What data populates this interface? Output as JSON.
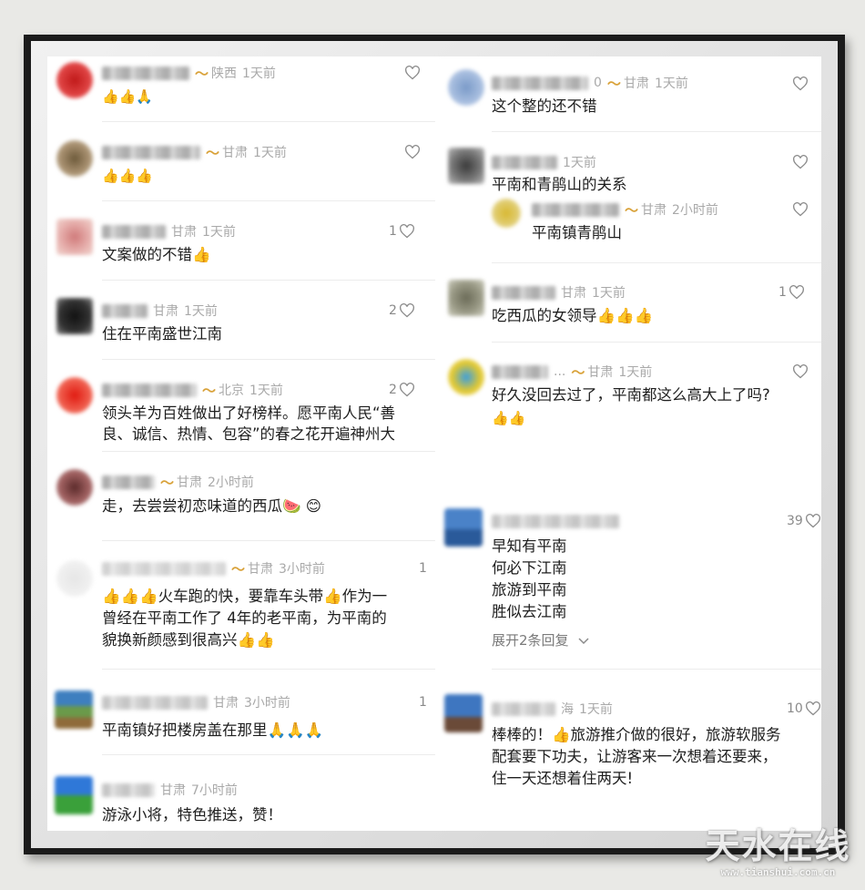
{
  "colors": {
    "badge": "#d9a23a",
    "meta_gray": "#a9a9a9",
    "text": "#1e1e1e",
    "frame": "#1b1b1b"
  },
  "icons": {
    "like": "heart-outline-icon",
    "expand": "chevron-down-icon",
    "badge": "vip-badge-icon"
  },
  "left_comments": [
    {
      "location": "陕西",
      "time": "1天前",
      "text": "👍👍🙏",
      "likes": ""
    },
    {
      "location": "甘肃",
      "time": "1天前",
      "text": "👍👍👍",
      "likes": ""
    },
    {
      "location": "甘肃",
      "time": "1天前",
      "text": "文案做的不错👍",
      "likes": "1"
    },
    {
      "location": "甘肃",
      "time": "1天前",
      "text": "住在平南盛世江南",
      "likes": "2"
    },
    {
      "location": "北京",
      "time": "1天前",
      "text_lines": [
        "领头羊为百姓做出了好榜样。愿平南人民“善",
        "良、诚信、热情、包容”的春之花开遍神州大"
      ],
      "likes": "2"
    },
    {
      "location": "甘肃",
      "time": "2小时前",
      "text": "走，去尝尝初恋味道的西瓜🍉 😊",
      "likes": ""
    },
    {
      "location": "甘肃",
      "time": "3小时前",
      "text_lines": [
        "👍👍👍火车跑的快，要靠车头带👍作为一",
        "曾经在平南工作了 4年的老平南，为平南的",
        "貌换新颜感到很高兴👍👍"
      ],
      "likes": "1"
    },
    {
      "location": "甘肃",
      "time": "3小时前",
      "text": "平南镇好把楼房盖在那里🙏🙏🙏",
      "likes": "1"
    },
    {
      "location": "甘肃",
      "time": "7小时前",
      "text": "游泳小将，特色推送，赞！",
      "likes": ""
    }
  ],
  "right_comments": [
    {
      "name_tail": "0",
      "location": "甘肃",
      "time": "1天前",
      "text": "这个整的还不错",
      "likes": ""
    },
    {
      "location": "",
      "time": "1天前",
      "text": "平南和青鹃山的关系",
      "likes": ""
    },
    {
      "location": "甘肃",
      "time": "2小时前",
      "text": "平南镇青鹃山",
      "likes": ""
    },
    {
      "location": "甘肃",
      "time": "1天前",
      "text": "吃西瓜的女领导👍👍👍",
      "likes": "1"
    },
    {
      "name_tail": "...",
      "location": "甘肃",
      "time": "1天前",
      "text_lines": [
        "好久没回去过了，平南都这么高大上了吗?",
        "👍👍"
      ],
      "likes": ""
    },
    {
      "location": "",
      "time": "",
      "text_lines": [
        "早知有平南",
        "何必下江南",
        "旅游到平南",
        "胜似去江南"
      ],
      "likes": "39",
      "expand": "展开2条回复"
    },
    {
      "location": "海",
      "time": "1天前",
      "text_lines": [
        "棒棒的！👍旅游推介做的很好，旅游软服务",
        "配套要下功夫，让游客来一次想着还要来，",
        "住一天还想着住两天!"
      ],
      "likes": "10"
    }
  ],
  "watermark": {
    "main": "天水在线",
    "url": "www.tianshui.com.cn"
  }
}
